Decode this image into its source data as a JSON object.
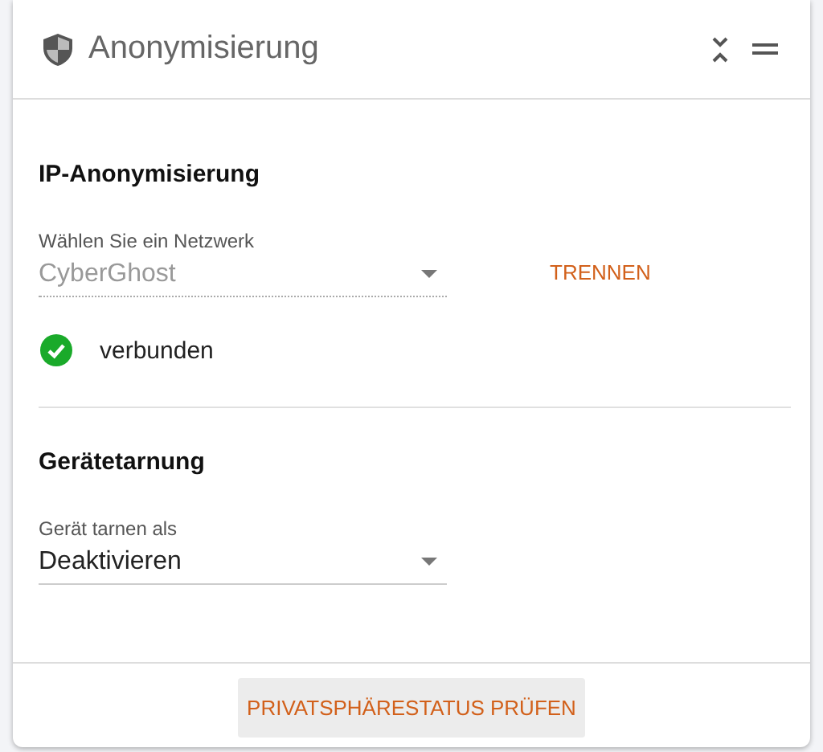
{
  "header": {
    "title": "Anonymisierung"
  },
  "ip_section": {
    "title": "IP-Anonymisierung",
    "network_select": {
      "label": "Wählen Sie ein Netzwerk",
      "value": "CyberGhost",
      "disabled": true
    },
    "disconnect_button": "TRENNEN",
    "status": {
      "connected": true,
      "text": "verbunden"
    }
  },
  "device_section": {
    "title": "Gerätetarnung",
    "device_select": {
      "label": "Gerät tarnen als",
      "value": "Deaktivieren",
      "disabled": false
    }
  },
  "footer": {
    "button": "PRIVATSPHÄRESTATUS PRÜFEN"
  }
}
